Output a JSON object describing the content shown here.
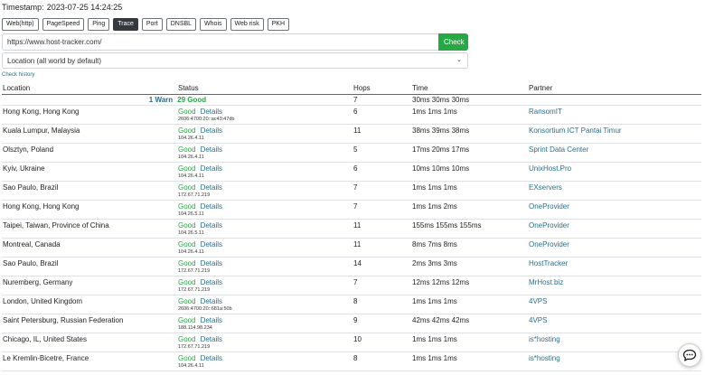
{
  "timestamp": {
    "label": "Timestamp:",
    "value": "2023-07-25 14:24:25"
  },
  "tabs": [
    {
      "label": "Web(http)",
      "active": false
    },
    {
      "label": "PageSpeed",
      "active": false
    },
    {
      "label": "Ping",
      "active": false
    },
    {
      "label": "Trace",
      "active": true
    },
    {
      "label": "Port",
      "active": false
    },
    {
      "label": "DNSBL",
      "active": false
    },
    {
      "label": "Whois",
      "active": false
    },
    {
      "label": "Web risk",
      "active": false
    },
    {
      "label": "PKH",
      "active": false
    }
  ],
  "url_input": {
    "value": "https://www.host-tracker.com/"
  },
  "check_button": {
    "label": "Check",
    "color": "#28a745"
  },
  "location_select": {
    "selected": "Location (all world by default)"
  },
  "check_history": {
    "label": "Check history"
  },
  "table": {
    "headers": {
      "location": "Location",
      "status": "Status",
      "hops": "Hops",
      "time": "Time",
      "partner": "Partner"
    },
    "summary": {
      "warn": "1 Warn",
      "good": "29 Good",
      "hops": "7",
      "time": "30ms 30ms 30ms"
    },
    "good_label": "Good",
    "details_label": "Details",
    "rows": [
      {
        "location": "Hong Kong, Hong Kong",
        "ip": "2606:4700:20::ac43:47db",
        "hops": "6",
        "time": "1ms  1ms  1ms",
        "partner": "RansomIT"
      },
      {
        "location": "Kuala Lumpur, Malaysia",
        "ip": "104.26.4.11",
        "hops": "11",
        "time": "38ms  39ms  38ms",
        "partner": "Konsortium ICT Pantai Timur"
      },
      {
        "location": "Olsztyn, Poland",
        "ip": "104.26.4.11",
        "hops": "5",
        "time": "17ms  20ms  17ms",
        "partner": "Sprint Data Center"
      },
      {
        "location": "Kyiv, Ukraine",
        "ip": "104.26.4.11",
        "hops": "6",
        "time": "10ms  10ms  10ms",
        "partner": "UnixHost.Pro"
      },
      {
        "location": "Sao Paulo, Brazil",
        "ip": "172.67.71.219",
        "hops": "7",
        "time": "1ms  1ms  1ms",
        "partner": "EXservers"
      },
      {
        "location": "Hong Kong, Hong Kong",
        "ip": "104.26.5.11",
        "hops": "7",
        "time": "1ms  1ms  2ms",
        "partner": "OneProvider"
      },
      {
        "location": "Taipei, Taiwan, Province of China",
        "ip": "104.26.5.11",
        "hops": "11",
        "time": "155ms  155ms  155ms",
        "partner": "OneProvider"
      },
      {
        "location": "Montreal, Canada",
        "ip": "104.26.4.11",
        "hops": "11",
        "time": "8ms  7ms  8ms",
        "partner": "OneProvider"
      },
      {
        "location": "Sao Paulo, Brazil",
        "ip": "172.67.71.219",
        "hops": "14",
        "time": "2ms  3ms  3ms",
        "partner": "HostTracker"
      },
      {
        "location": "Nuremberg, Germany",
        "ip": "172.67.71.219",
        "hops": "7",
        "time": "12ms  12ms  12ms",
        "partner": "MrHost.biz"
      },
      {
        "location": "London, United Kingdom",
        "ip": "2606:4700:20::681a:50b",
        "hops": "8",
        "time": "1ms  1ms  1ms",
        "partner": "4VPS"
      },
      {
        "location": "Saint Petersburg, Russian Federation",
        "ip": "188.114.98.234",
        "hops": "9",
        "time": "42ms  42ms  42ms",
        "partner": "4VPS"
      },
      {
        "location": "Chicago, IL, United States",
        "ip": "172.67.71.219",
        "hops": "10",
        "time": "1ms  1ms  1ms",
        "partner": "is*hosting"
      },
      {
        "location": "Le Kremlin-Bicetre, France",
        "ip": "104.26.4.11",
        "hops": "8",
        "time": "1ms  1ms  1ms",
        "partner": "is*hosting"
      }
    ]
  },
  "colors": {
    "good": "#28a745",
    "link": "#2a6f8a",
    "active_tab": "#343a40"
  },
  "chat": {
    "icon": "chat-bubble-icon"
  }
}
